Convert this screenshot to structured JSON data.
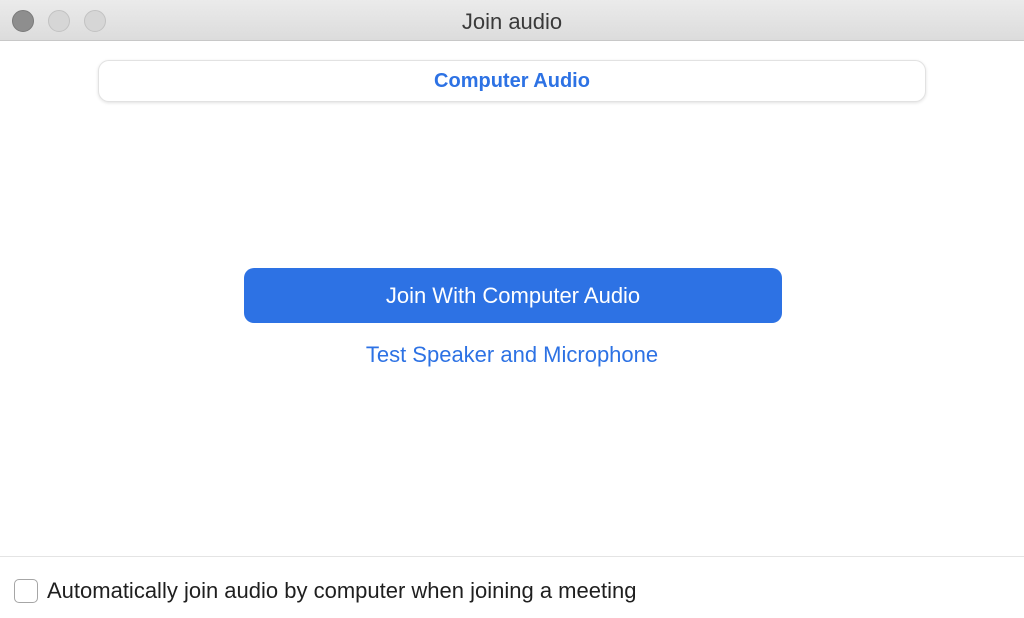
{
  "window": {
    "title": "Join audio"
  },
  "tabs": {
    "active_label": "Computer Audio"
  },
  "main": {
    "join_button_label": "Join With Computer Audio",
    "test_link_label": "Test Speaker and Microphone"
  },
  "footer": {
    "auto_join_label": "Automatically join audio by computer when joining a meeting",
    "auto_join_checked": false
  },
  "colors": {
    "accent": "#2d72e4",
    "window_bg": "#ffffff",
    "titlebar_bg": "#dcdcdc"
  }
}
